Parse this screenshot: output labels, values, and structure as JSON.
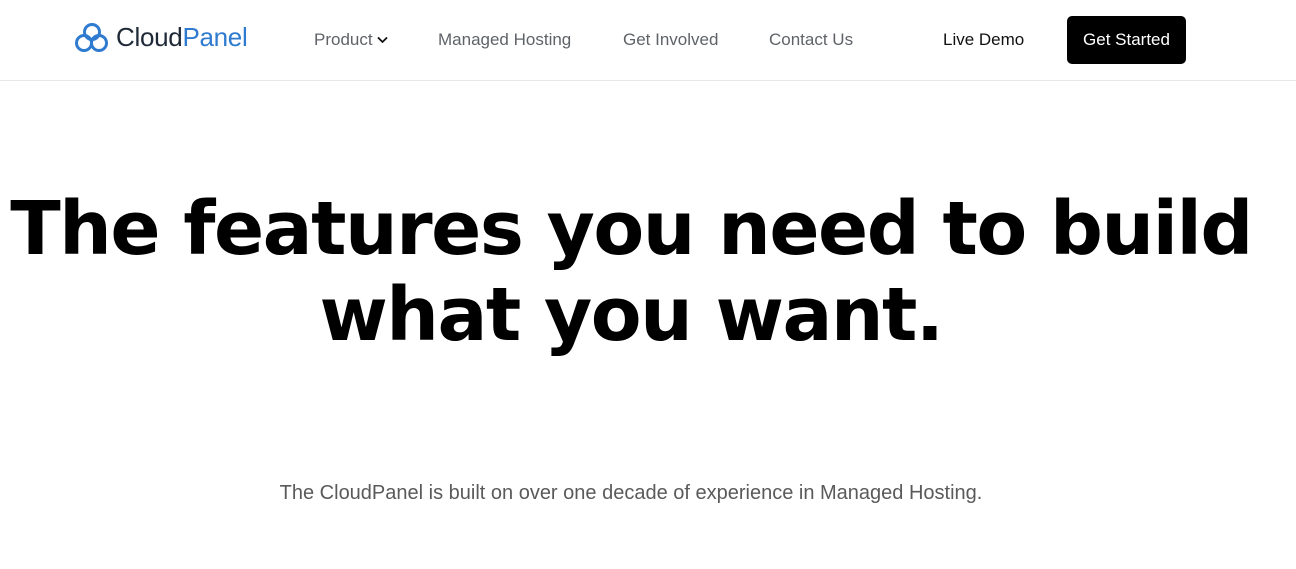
{
  "brand": {
    "name_part1": "Cloud",
    "name_part2": "Panel",
    "accent_color": "#2f7bd0",
    "icon": "cloud-logo-icon"
  },
  "nav": {
    "product_label": "Product",
    "product_icon": "chevron-down-icon",
    "managed_hosting_label": "Managed Hosting",
    "get_involved_label": "Get Involved",
    "contact_label": "Contact Us",
    "live_demo_label": "Live Demo",
    "cta_label": "Get Started"
  },
  "hero": {
    "headline": "The features you need to build what you want.",
    "subheadline": "The CloudPanel is built on over one decade of experience in Managed Hosting."
  }
}
